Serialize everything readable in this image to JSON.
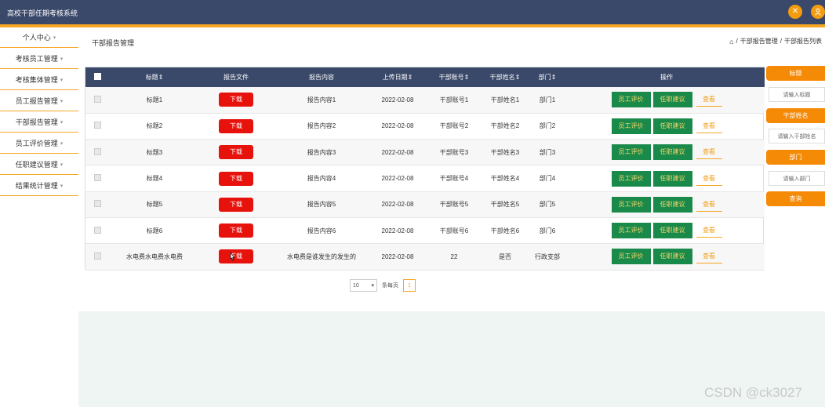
{
  "header": {
    "app_title": "高校干部任期考核系统",
    "close_icon": "✕",
    "user_icon": "person-icon"
  },
  "sidebar": {
    "items": [
      {
        "label": "个人中心"
      },
      {
        "label": "考核员工管理"
      },
      {
        "label": "考核集体管理"
      },
      {
        "label": "员工报告管理"
      },
      {
        "label": "干部报告管理"
      },
      {
        "label": "员工评价管理"
      },
      {
        "label": "任职建议管理"
      },
      {
        "label": "结果统计管理"
      }
    ]
  },
  "page": {
    "title": "干部报告管理",
    "breadcrumb": [
      "干部报告管理",
      "干部报告列表"
    ]
  },
  "table": {
    "headers": [
      "标题",
      "报告文件",
      "报告内容",
      "上传日期",
      "干部账号",
      "干部姓名",
      "部门",
      "操作"
    ],
    "rows": [
      {
        "title": "标题1",
        "file": "下载",
        "content": "报告内容1",
        "date": "2022-02-08",
        "account": "干部账号1",
        "name": "干部姓名1",
        "dept": "部门1"
      },
      {
        "title": "标题2",
        "file": "下载",
        "content": "报告内容2",
        "date": "2022-02-08",
        "account": "干部账号2",
        "name": "干部姓名2",
        "dept": "部门2"
      },
      {
        "title": "标题3",
        "file": "下载",
        "content": "报告内容3",
        "date": "2022-02-08",
        "account": "干部账号3",
        "name": "干部姓名3",
        "dept": "部门3"
      },
      {
        "title": "标题4",
        "file": "下载",
        "content": "报告内容4",
        "date": "2022-02-08",
        "account": "干部账号4",
        "name": "干部姓名4",
        "dept": "部门4"
      },
      {
        "title": "标题5",
        "file": "下载",
        "content": "报告内容5",
        "date": "2022-02-08",
        "account": "干部账号5",
        "name": "干部姓名5",
        "dept": "部门5"
      },
      {
        "title": "标题6",
        "file": "下载",
        "content": "报告内容6",
        "date": "2022-02-08",
        "account": "干部账号6",
        "name": "干部姓名6",
        "dept": "部门6"
      },
      {
        "title": "水电费水电费水电费",
        "file": "下载",
        "content": "水电费是谁发生的发生的",
        "date": "2022-02-08",
        "account": "22",
        "name": "是否",
        "dept": "行政支部"
      }
    ],
    "actions": {
      "evaluate": "员工评价",
      "suggest": "任职建议",
      "view": "查看"
    }
  },
  "pagination": {
    "page_size": "10",
    "per_page_label": "条每页",
    "current_page": "1"
  },
  "search_panel": {
    "title_label": "标题",
    "title_placeholder": "请输入标题",
    "name_label": "干部姓名",
    "name_placeholder": "请输入干部姓名",
    "dept_label": "部门",
    "dept_placeholder": "请输入部门",
    "query_button": "查询"
  },
  "watermark": "CSDN @ck3027",
  "colors": {
    "header_bg": "#3a4869",
    "accent": "#f5a623",
    "orange_button": "#f58a07",
    "download_red": "#e8120c",
    "action_green": "#1a8a4a"
  }
}
